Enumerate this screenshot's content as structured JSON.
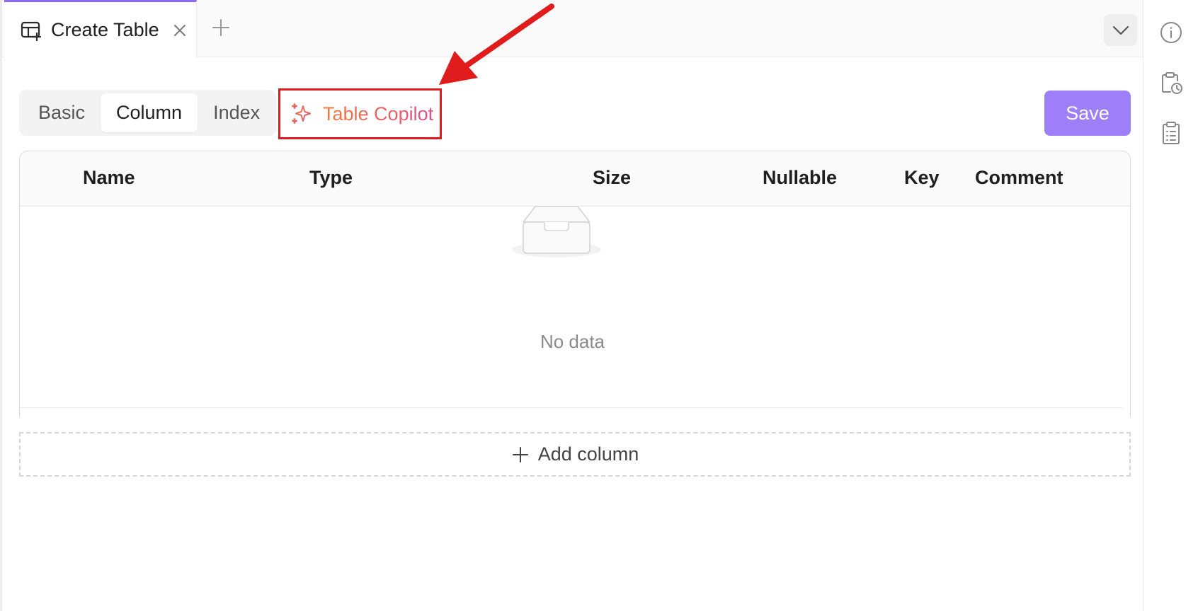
{
  "tabs": [
    {
      "label": "Create Table",
      "icon": "table-add-icon",
      "active": true
    }
  ],
  "tab_actions": {
    "add_icon": "plus-icon",
    "dropdown_icon": "chevron-down-icon"
  },
  "segments": [
    {
      "label": "Basic",
      "active": false
    },
    {
      "label": "Column",
      "active": true
    },
    {
      "label": "Index",
      "active": false
    }
  ],
  "copilot": {
    "label": "Table Copilot",
    "icon": "sparkle-icon"
  },
  "save_label": "Save",
  "table": {
    "columns": [
      "Name",
      "Type",
      "Size",
      "Nullable",
      "Key",
      "Comment"
    ],
    "rows": [],
    "empty_text": "No data"
  },
  "add_column_label": "Add column",
  "right_sidebar": [
    "info-icon",
    "clipboard-clock-icon",
    "clipboard-list-icon"
  ],
  "colors": {
    "accent": "#9f7ff7",
    "tab_indicator": "#8b6cf0",
    "copilot_gradient": [
      "#ee7a3a",
      "#e0508a"
    ],
    "annotation": "#e01b1b"
  }
}
